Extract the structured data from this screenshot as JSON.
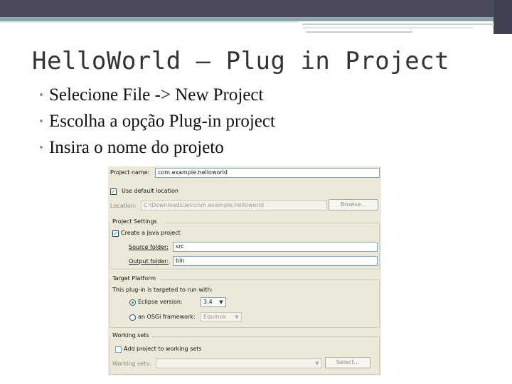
{
  "slide": {
    "title": "HelloWorld – Plug in Project",
    "bullets": [
      "Selecione File -> New Project",
      "Escolha a opção Plug-in project",
      "Insira o nome do projeto"
    ]
  },
  "dialog": {
    "project_name_label": "Project name:",
    "project_name_value": "com.example.helloworld",
    "use_default_location_label": "Use default location",
    "location_label": "Location:",
    "location_value": "C:\\Downloads\\ws\\com.example.helloworld",
    "browse_button": "Browse...",
    "project_settings": {
      "group_label": "Project Settings",
      "create_java_project_label": "Create a Java project",
      "source_folder_label": "Source folder:",
      "source_folder_value": "src",
      "output_folder_label": "Output folder:",
      "output_folder_value": "bin"
    },
    "target_platform": {
      "group_label": "Target Platform",
      "description": "This plug-in is targeted to run with:",
      "eclipse_version_label": "Eclipse version:",
      "eclipse_version_value": "3.4",
      "osgi_framework_label": "an OSGi framework:",
      "osgi_framework_value": "Equinox"
    },
    "working_sets": {
      "group_label": "Working sets",
      "add_to_working_sets_label": "Add project to working sets",
      "working_sets_label": "Working sets:",
      "select_button": "Select..."
    }
  },
  "colors": {
    "top_bar": "#4a4a5a",
    "accent": "#8fa6ad",
    "dialog_bg": "#ece9d8",
    "check_green": "#21a121"
  }
}
